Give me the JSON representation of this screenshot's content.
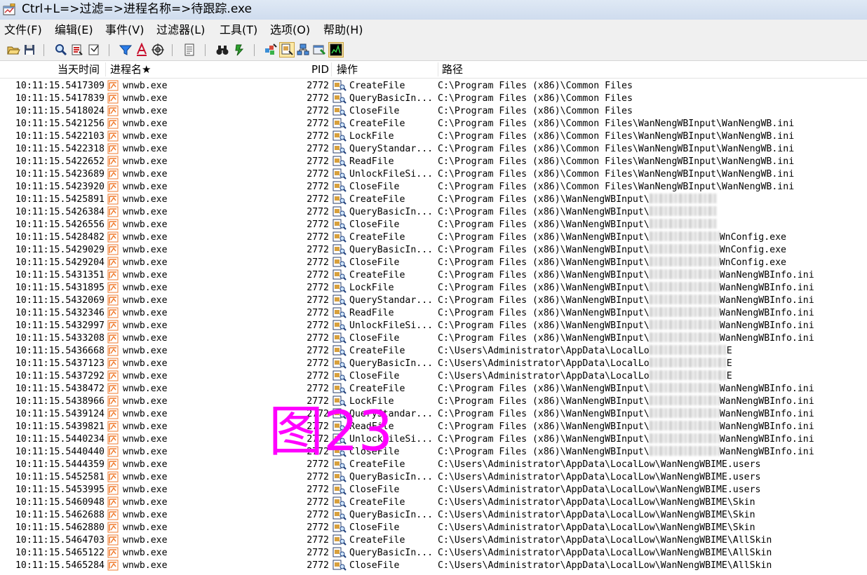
{
  "window": {
    "title": "Ctrl+L=>过滤=>进程名称=>待跟踪.exe",
    "app_icon": "process-monitor-icon"
  },
  "menu": [
    {
      "label": "文件(F)"
    },
    {
      "label": "编辑(E)"
    },
    {
      "label": "事件(V)"
    },
    {
      "label": "过滤器(L)"
    },
    {
      "label": "工具(T)"
    },
    {
      "label": "选项(O)"
    },
    {
      "label": "帮助(H)"
    }
  ],
  "toolbar": [
    "open-icon",
    "save-icon",
    "find-icon",
    "highlight-icon",
    "autoscroll-icon",
    "filter-icon",
    "clear-icon",
    "target-icon",
    "properties-icon",
    "search-binoculars-icon",
    "jump-icon",
    "registry-activity-icon",
    "file-activity-icon",
    "network-activity-icon",
    "process-activity-icon",
    "profiling-icon"
  ],
  "columns": {
    "time": "当天时间",
    "process": "进程名★",
    "pid": "PID",
    "operation": "操作",
    "path": "路径"
  },
  "colors": {
    "watermark": "#ff00ff",
    "title_bar": "#dbe6f4",
    "menu_bg": "#f0f0f0"
  },
  "watermark": "图23",
  "rows": [
    {
      "time": "10:11:15.5417309",
      "process": "wnwb.exe",
      "pid": "2772",
      "op": "CreateFile",
      "path": "C:\\Program Files (x86)\\Common Files",
      "tail": ""
    },
    {
      "time": "10:11:15.5417839",
      "process": "wnwb.exe",
      "pid": "2772",
      "op": "QueryBasicIn...",
      "path": "C:\\Program Files (x86)\\Common Files",
      "tail": ""
    },
    {
      "time": "10:11:15.5418024",
      "process": "wnwb.exe",
      "pid": "2772",
      "op": "CloseFile",
      "path": "C:\\Program Files (x86)\\Common Files",
      "tail": ""
    },
    {
      "time": "10:11:15.5421256",
      "process": "wnwb.exe",
      "pid": "2772",
      "op": "CreateFile",
      "path": "C:\\Program Files (x86)\\Common Files\\WanNengWBInput\\WanNengWB.ini",
      "tail": ""
    },
    {
      "time": "10:11:15.5422103",
      "process": "wnwb.exe",
      "pid": "2772",
      "op": "LockFile",
      "path": "C:\\Program Files (x86)\\Common Files\\WanNengWBInput\\WanNengWB.ini",
      "tail": ""
    },
    {
      "time": "10:11:15.5422318",
      "process": "wnwb.exe",
      "pid": "2772",
      "op": "QueryStandar...",
      "path": "C:\\Program Files (x86)\\Common Files\\WanNengWBInput\\WanNengWB.ini",
      "tail": ""
    },
    {
      "time": "10:11:15.5422652",
      "process": "wnwb.exe",
      "pid": "2772",
      "op": "ReadFile",
      "path": "C:\\Program Files (x86)\\Common Files\\WanNengWBInput\\WanNengWB.ini",
      "tail": ""
    },
    {
      "time": "10:11:15.5423689",
      "process": "wnwb.exe",
      "pid": "2772",
      "op": "UnlockFileSi...",
      "path": "C:\\Program Files (x86)\\Common Files\\WanNengWBInput\\WanNengWB.ini",
      "tail": ""
    },
    {
      "time": "10:11:15.5423920",
      "process": "wnwb.exe",
      "pid": "2772",
      "op": "CloseFile",
      "path": "C:\\Program Files (x86)\\Common Files\\WanNengWBInput\\WanNengWB.ini",
      "tail": ""
    },
    {
      "time": "10:11:15.5425891",
      "process": "wnwb.exe",
      "pid": "2772",
      "op": "CreateFile",
      "path": "C:\\Program Files (x86)\\WanNengWBInput\\",
      "tail": "",
      "blur": "short"
    },
    {
      "time": "10:11:15.5426384",
      "process": "wnwb.exe",
      "pid": "2772",
      "op": "QueryBasicIn...",
      "path": "C:\\Program Files (x86)\\WanNengWBInput\\",
      "tail": "",
      "blur": "short"
    },
    {
      "time": "10:11:15.5426556",
      "process": "wnwb.exe",
      "pid": "2772",
      "op": "CloseFile",
      "path": "C:\\Program Files (x86)\\WanNengWBInput\\",
      "tail": "",
      "blur": "short"
    },
    {
      "time": "10:11:15.5428482",
      "process": "wnwb.exe",
      "pid": "2772",
      "op": "CreateFile",
      "path": "C:\\Program Files (x86)\\WanNengWBInput\\",
      "tail": "WnConfig.exe",
      "blur": "long"
    },
    {
      "time": "10:11:15.5429029",
      "process": "wnwb.exe",
      "pid": "2772",
      "op": "QueryBasicIn...",
      "path": "C:\\Program Files (x86)\\WanNengWBInput\\",
      "tail": "WnConfig.exe",
      "blur": "long"
    },
    {
      "time": "10:11:15.5429204",
      "process": "wnwb.exe",
      "pid": "2772",
      "op": "CloseFile",
      "path": "C:\\Program Files (x86)\\WanNengWBInput\\",
      "tail": "WnConfig.exe",
      "blur": "long"
    },
    {
      "time": "10:11:15.5431351",
      "process": "wnwb.exe",
      "pid": "2772",
      "op": "CreateFile",
      "path": "C:\\Program Files (x86)\\WanNengWBInput\\",
      "tail": "WanNengWBInfo.ini",
      "blur": "long"
    },
    {
      "time": "10:11:15.5431895",
      "process": "wnwb.exe",
      "pid": "2772",
      "op": "LockFile",
      "path": "C:\\Program Files (x86)\\WanNengWBInput\\",
      "tail": "WanNengWBInfo.ini",
      "blur": "long"
    },
    {
      "time": "10:11:15.5432069",
      "process": "wnwb.exe",
      "pid": "2772",
      "op": "QueryStandar...",
      "path": "C:\\Program Files (x86)\\WanNengWBInput\\",
      "tail": "WanNengWBInfo.ini",
      "blur": "long"
    },
    {
      "time": "10:11:15.5432346",
      "process": "wnwb.exe",
      "pid": "2772",
      "op": "ReadFile",
      "path": "C:\\Program Files (x86)\\WanNengWBInput\\",
      "tail": "WanNengWBInfo.ini",
      "blur": "long"
    },
    {
      "time": "10:11:15.5432997",
      "process": "wnwb.exe",
      "pid": "2772",
      "op": "UnlockFileSi...",
      "path": "C:\\Program Files (x86)\\WanNengWBInput\\",
      "tail": "WanNengWBInfo.ini",
      "blur": "long"
    },
    {
      "time": "10:11:15.5433208",
      "process": "wnwb.exe",
      "pid": "2772",
      "op": "CloseFile",
      "path": "C:\\Program Files (x86)\\WanNengWBInput\\",
      "tail": "WanNengWBInfo.ini",
      "blur": "long"
    },
    {
      "time": "10:11:15.5436668",
      "process": "wnwb.exe",
      "pid": "2772",
      "op": "CreateFile",
      "path": "C:\\Users\\Administrator\\AppData\\LocalLo",
      "tail": "E",
      "blur": "mid"
    },
    {
      "time": "10:11:15.5437123",
      "process": "wnwb.exe",
      "pid": "2772",
      "op": "QueryBasicIn...",
      "path": "C:\\Users\\Administrator\\AppData\\LocalLo",
      "tail": "E",
      "blur": "mid"
    },
    {
      "time": "10:11:15.5437292",
      "process": "wnwb.exe",
      "pid": "2772",
      "op": "CloseFile",
      "path": "C:\\Users\\Administrator\\AppData\\LocalLo",
      "tail": "E",
      "blur": "mid"
    },
    {
      "time": "10:11:15.5438472",
      "process": "wnwb.exe",
      "pid": "2772",
      "op": "CreateFile",
      "path": "C:\\Program Files (x86)\\WanNengWBInput\\",
      "tail": "WanNengWBInfo.ini",
      "blur": "long"
    },
    {
      "time": "10:11:15.5438966",
      "process": "wnwb.exe",
      "pid": "2772",
      "op": "LockFile",
      "path": "C:\\Program Files (x86)\\WanNengWBInput\\",
      "tail": "WanNengWBInfo.ini",
      "blur": "long"
    },
    {
      "time": "10:11:15.5439124",
      "process": "wnwb.exe",
      "pid": "2772",
      "op": "QueryStandar...",
      "path": "C:\\Program Files (x86)\\WanNengWBInput\\",
      "tail": "WanNengWBInfo.ini",
      "blur": "long"
    },
    {
      "time": "10:11:15.5439821",
      "process": "wnwb.exe",
      "pid": "2772",
      "op": "ReadFile",
      "path": "C:\\Program Files (x86)\\WanNengWBInput\\",
      "tail": "WanNengWBInfo.ini",
      "blur": "long"
    },
    {
      "time": "10:11:15.5440234",
      "process": "wnwb.exe",
      "pid": "2772",
      "op": "UnlockFileSi...",
      "path": "C:\\Program Files (x86)\\WanNengWBInput\\",
      "tail": "WanNengWBInfo.ini",
      "blur": "long"
    },
    {
      "time": "10:11:15.5440440",
      "process": "wnwb.exe",
      "pid": "2772",
      "op": "CloseFile",
      "path": "C:\\Program Files (x86)\\WanNengWBInput\\",
      "tail": "WanNengWBInfo.ini",
      "blur": "long"
    },
    {
      "time": "10:11:15.5444359",
      "process": "wnwb.exe",
      "pid": "2772",
      "op": "CreateFile",
      "path": "C:\\Users\\Administrator\\AppData\\LocalLow\\WanNengWBIME.users",
      "tail": ""
    },
    {
      "time": "10:11:15.5452581",
      "process": "wnwb.exe",
      "pid": "2772",
      "op": "QueryBasicIn...",
      "path": "C:\\Users\\Administrator\\AppData\\LocalLow\\WanNengWBIME.users",
      "tail": ""
    },
    {
      "time": "10:11:15.5453995",
      "process": "wnwb.exe",
      "pid": "2772",
      "op": "CloseFile",
      "path": "C:\\Users\\Administrator\\AppData\\LocalLow\\WanNengWBIME.users",
      "tail": ""
    },
    {
      "time": "10:11:15.5460948",
      "process": "wnwb.exe",
      "pid": "2772",
      "op": "CreateFile",
      "path": "C:\\Users\\Administrator\\AppData\\LocalLow\\WanNengWBIME\\Skin",
      "tail": ""
    },
    {
      "time": "10:11:15.5462688",
      "process": "wnwb.exe",
      "pid": "2772",
      "op": "QueryBasicIn...",
      "path": "C:\\Users\\Administrator\\AppData\\LocalLow\\WanNengWBIME\\Skin",
      "tail": ""
    },
    {
      "time": "10:11:15.5462880",
      "process": "wnwb.exe",
      "pid": "2772",
      "op": "CloseFile",
      "path": "C:\\Users\\Administrator\\AppData\\LocalLow\\WanNengWBIME\\Skin",
      "tail": ""
    },
    {
      "time": "10:11:15.5464703",
      "process": "wnwb.exe",
      "pid": "2772",
      "op": "CreateFile",
      "path": "C:\\Users\\Administrator\\AppData\\LocalLow\\WanNengWBIME\\AllSkin",
      "tail": ""
    },
    {
      "time": "10:11:15.5465122",
      "process": "wnwb.exe",
      "pid": "2772",
      "op": "QueryBasicIn...",
      "path": "C:\\Users\\Administrator\\AppData\\LocalLow\\WanNengWBIME\\AllSkin",
      "tail": ""
    },
    {
      "time": "10:11:15.5465284",
      "process": "wnwb.exe",
      "pid": "2772",
      "op": "CloseFile",
      "path": "C:\\Users\\Administrator\\AppData\\LocalLow\\WanNengWBIME\\AllSkin",
      "tail": ""
    }
  ]
}
